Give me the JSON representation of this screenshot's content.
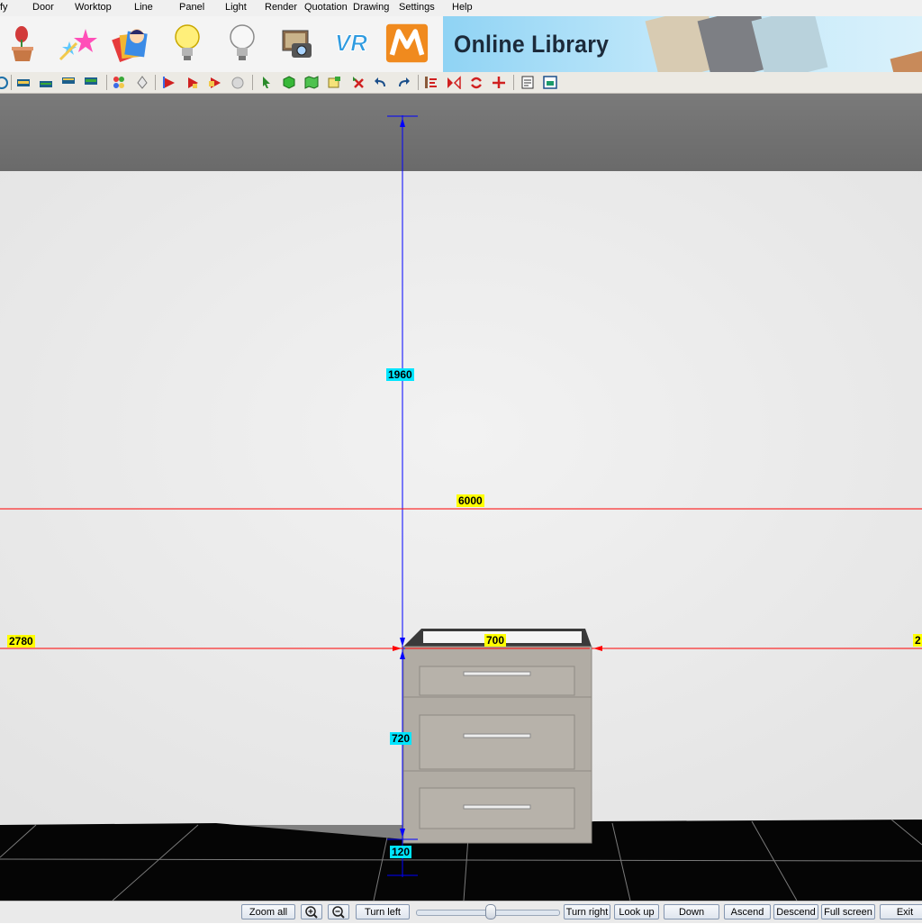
{
  "menu": {
    "items": [
      "fy",
      "Door",
      "Worktop",
      "Line",
      "Panel",
      "Light",
      "Render",
      "Quotation",
      "Drawing",
      "Settings",
      "Help"
    ]
  },
  "big_toolbar": {
    "icons": [
      "plant-pot-icon",
      "fireworks-stars-icon",
      "color-swatches-icon",
      "user-profile-icon",
      "light-bulb-on-icon",
      "light-bulb-off-icon",
      "photo-camera-icon",
      "vr-icon",
      "m-logo-icon"
    ],
    "vr_text": "VR"
  },
  "banner": {
    "title": "Online Library"
  },
  "small_toolbar": {
    "icons": [
      "cabinet-base-icon",
      "cabinet-low-icon",
      "cabinet-wall-icon",
      "cabinet-top-icon",
      "palette-icon",
      "pen-icon",
      "flag-red-icon",
      "flag-play-icon",
      "flag-yellow-icon",
      "circle-gray-icon",
      "pointer-icon",
      "cube-green-icon",
      "map-icon",
      "select-box-icon",
      "delete-x-icon",
      "undo-icon",
      "redo-icon",
      "align-icon",
      "mirror-icon",
      "rotate-icon",
      "move-icon",
      "report-icon",
      "screenshot-icon"
    ]
  },
  "dimensions": {
    "height_above": "1960",
    "wall_width": "6000",
    "left_offset": "2780",
    "right_offset_partial": "2",
    "cabinet_width": "700",
    "cabinet_height": "720",
    "plinth_height": "120"
  },
  "controls": {
    "zoom_all": "Zoom all",
    "turn_left": "Turn left",
    "turn_right": "Turn right",
    "look_up": "Look up",
    "down": "Down",
    "ascend": "Ascend",
    "descend": "Descend",
    "full_screen": "Full screen",
    "exit": "Exit",
    "slider_value": 0.52
  },
  "colors": {
    "dim_blue_line": "#0000ff",
    "dim_red_line": "#ff0000",
    "dim_blue_label": "#00e5ff",
    "dim_yellow_label": "#ffff00",
    "cabinet": "#b1aca4",
    "wall": "#ebebeb",
    "floor": "#050505"
  }
}
